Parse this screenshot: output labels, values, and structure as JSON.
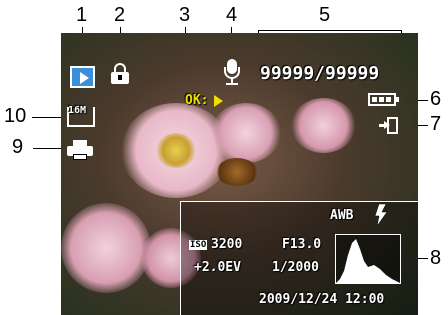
{
  "callouts": [
    "1",
    "2",
    "3",
    "4",
    "5",
    "6",
    "7",
    "8",
    "9",
    "10"
  ],
  "osd": {
    "mode_icon": "play-icon",
    "protect_icon": "lock-icon",
    "voice_status": "OK:",
    "voice_icon": "microphone-icon",
    "file_counter": "99999/99999",
    "battery_icon": "battery-icon",
    "dpof_icon": "dpof-icon",
    "print_icon": "printer-icon",
    "resolution": "16M",
    "histogram_panel": {
      "white_balance": "AWB",
      "flash_icon": "flash-icon",
      "iso_label": "ISO",
      "iso_value": "3200",
      "aperture": "F13.0",
      "exposure_comp": "+2.0EV",
      "shutter": "1/2000",
      "datetime": "2009/12/24  12:00"
    }
  },
  "colors": {
    "mode_icon_bg": "#3a8fd8",
    "voice_status": "#f0e000",
    "osd_text": "#ffffff"
  }
}
